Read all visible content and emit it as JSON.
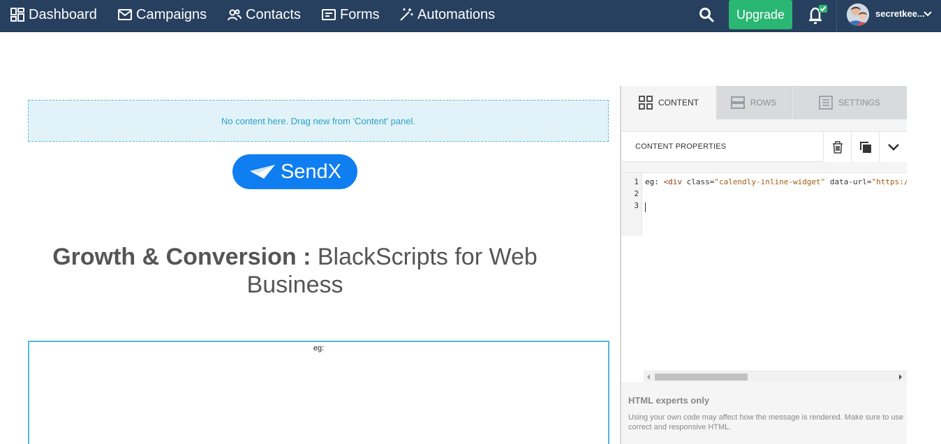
{
  "nav": {
    "items": [
      {
        "label": "Dashboard",
        "icon": "dashboard-icon"
      },
      {
        "label": "Campaigns",
        "icon": "envelope-icon"
      },
      {
        "label": "Contacts",
        "icon": "contacts-icon"
      },
      {
        "label": "Forms",
        "icon": "form-icon"
      },
      {
        "label": "Automations",
        "icon": "magic-wand-icon"
      }
    ],
    "upgrade_label": "Upgrade",
    "username": "secretkee...",
    "colors": {
      "nav_bg": "#27405f",
      "upgrade": "#2ab673",
      "notification_badge": "#2ab673"
    }
  },
  "canvas": {
    "dropzone_text": "No content here. Drag new from 'Content' panel.",
    "logo_text": "SendX",
    "headline_bold": "Growth & Conversion :",
    "headline_rest": " BlackScripts for Web Business",
    "html_block_text": "eg:",
    "colors": {
      "logo_bg": "#0f7ef0",
      "dropzone_bg": "#e1f3f9",
      "selection": "#51b7d8"
    }
  },
  "panel": {
    "tabs": [
      {
        "label": "CONTENT",
        "active": true
      },
      {
        "label": "ROWS",
        "active": false
      },
      {
        "label": "SETTINGS",
        "active": false
      }
    ],
    "properties_title": "CONTENT PROPERTIES",
    "code": {
      "line_numbers": [
        "1",
        "2",
        "3"
      ],
      "line1": {
        "prefix": "eg: ",
        "tag": "<div",
        "attr1": " class=",
        "val1": "\"calendly-inline-widget\"",
        "attr2": " data-url=",
        "val2": "\"https:/"
      }
    },
    "warning_title": "HTML experts only",
    "warning_text": "Using your own code may affect how the message is rendered. Make sure to use correct and responsive HTML."
  }
}
